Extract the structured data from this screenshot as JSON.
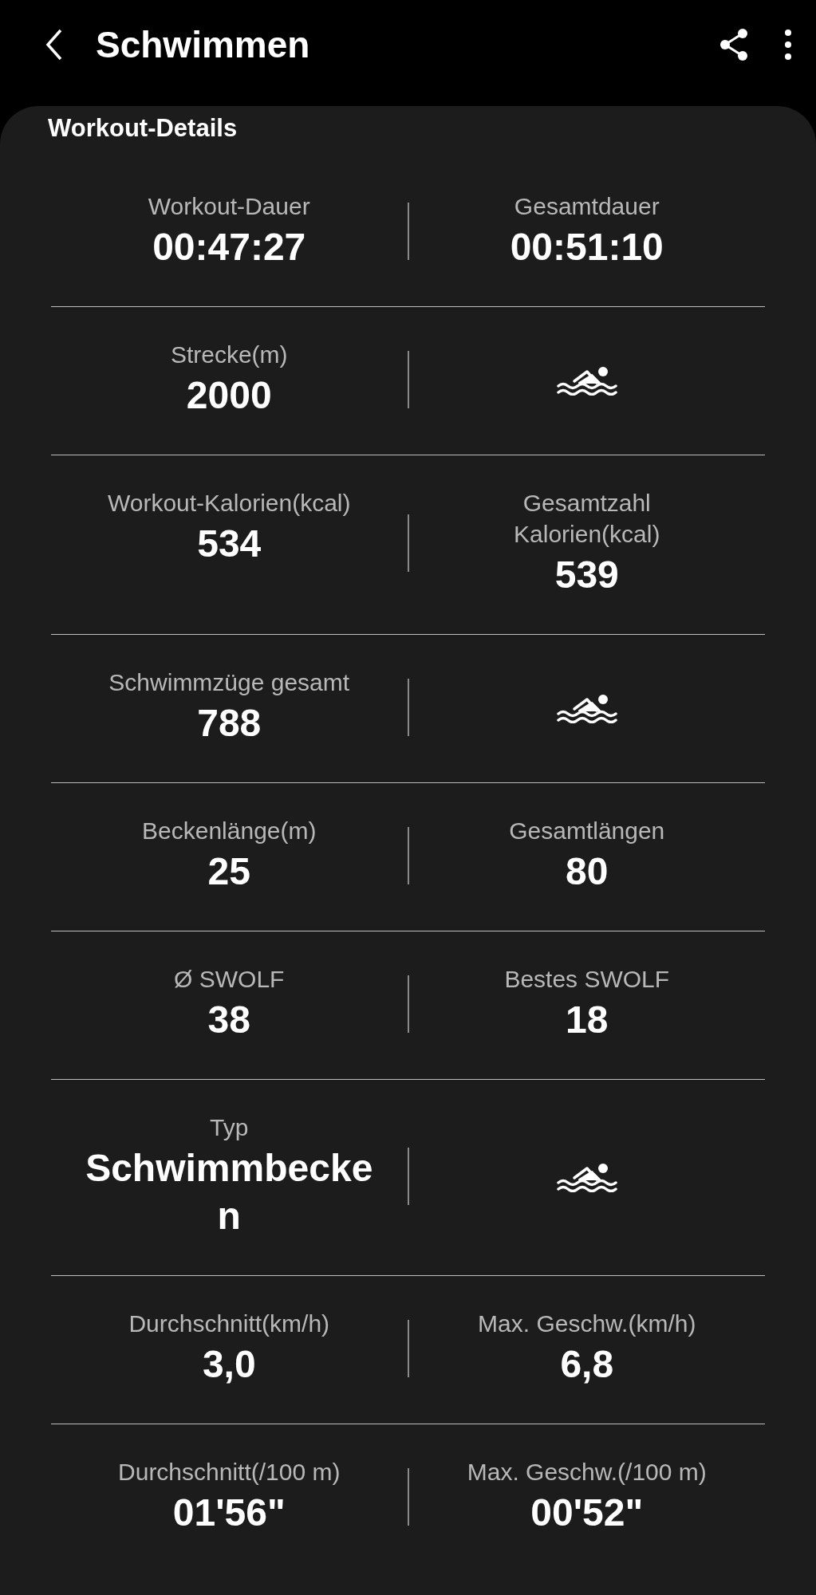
{
  "header": {
    "title": "Schwimmen"
  },
  "section": {
    "title": "Workout-Details"
  },
  "rows": [
    {
      "cells": [
        {
          "kind": "stat",
          "label": "Workout-Dauer",
          "value": "00:47:27"
        },
        {
          "kind": "stat",
          "label": "Gesamtdauer",
          "value": "00:51:10"
        }
      ]
    },
    {
      "cells": [
        {
          "kind": "stat",
          "label": "Strecke(m)",
          "value": "2000"
        },
        {
          "kind": "icon"
        }
      ]
    },
    {
      "cells": [
        {
          "kind": "stat",
          "label": "Workout-Kalorien(kcal)",
          "value": "534"
        },
        {
          "kind": "stat",
          "label": "Gesamtzahl Kalorien(kcal)",
          "value": "539"
        }
      ]
    },
    {
      "cells": [
        {
          "kind": "stat",
          "label": "Schwimmzüge gesamt",
          "value": "788"
        },
        {
          "kind": "icon"
        }
      ]
    },
    {
      "cells": [
        {
          "kind": "stat",
          "label": "Beckenlänge(m)",
          "value": "25"
        },
        {
          "kind": "stat",
          "label": "Gesamtlängen",
          "value": "80"
        }
      ]
    },
    {
      "cells": [
        {
          "kind": "stat",
          "label": "Ø SWOLF",
          "value": "38"
        },
        {
          "kind": "stat",
          "label": "Bestes SWOLF",
          "value": "18"
        }
      ]
    },
    {
      "cells": [
        {
          "kind": "stat",
          "label": "Typ",
          "value": "Schwimmbecken"
        },
        {
          "kind": "icon"
        }
      ]
    },
    {
      "cells": [
        {
          "kind": "stat",
          "label": "Durchschnitt(km/h)",
          "value": "3,0"
        },
        {
          "kind": "stat",
          "label": "Max. Geschw.(km/h)",
          "value": "6,8"
        }
      ]
    },
    {
      "cells": [
        {
          "kind": "stat",
          "label": "Durchschnitt(/100 m)",
          "value": "01'56\""
        },
        {
          "kind": "stat",
          "label": "Max. Geschw.(/100 m)",
          "value": "00'52\""
        }
      ]
    }
  ]
}
